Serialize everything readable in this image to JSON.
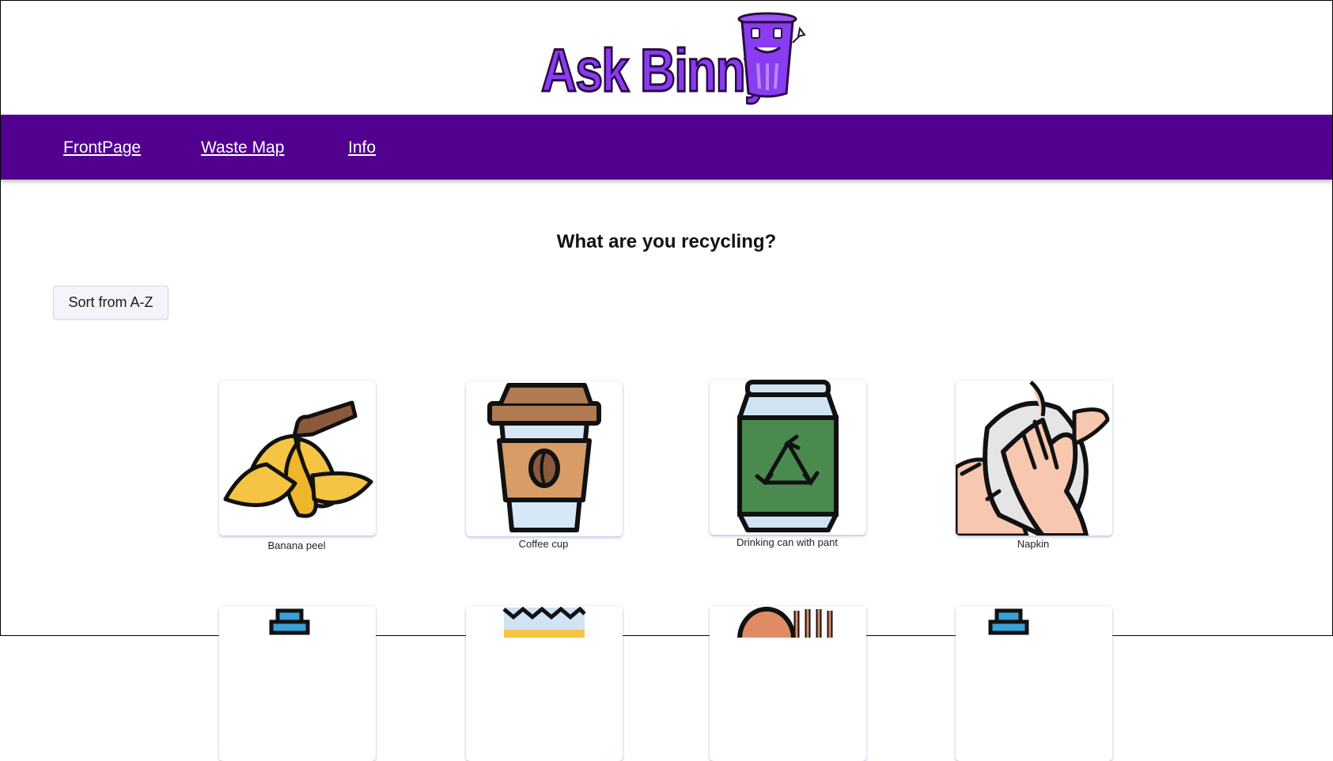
{
  "logo": {
    "text": "Ask Binny"
  },
  "nav": {
    "items": [
      "FrontPage",
      "Waste Map",
      "Info"
    ]
  },
  "main": {
    "heading": "What are you recycling?",
    "sort_label": "Sort from A-Z",
    "items": [
      {
        "label": "Banana peel",
        "icon": "banana-peel-icon"
      },
      {
        "label": "Coffee cup",
        "icon": "coffee-cup-icon"
      },
      {
        "label": "Drinking can with pant",
        "icon": "drinking-can-icon"
      },
      {
        "label": "Napkin",
        "icon": "napkin-icon"
      }
    ]
  },
  "colors": {
    "nav_bg": "#51008f",
    "logo_purple": "#8a3cf0",
    "can_green": "#4a8a4f"
  }
}
